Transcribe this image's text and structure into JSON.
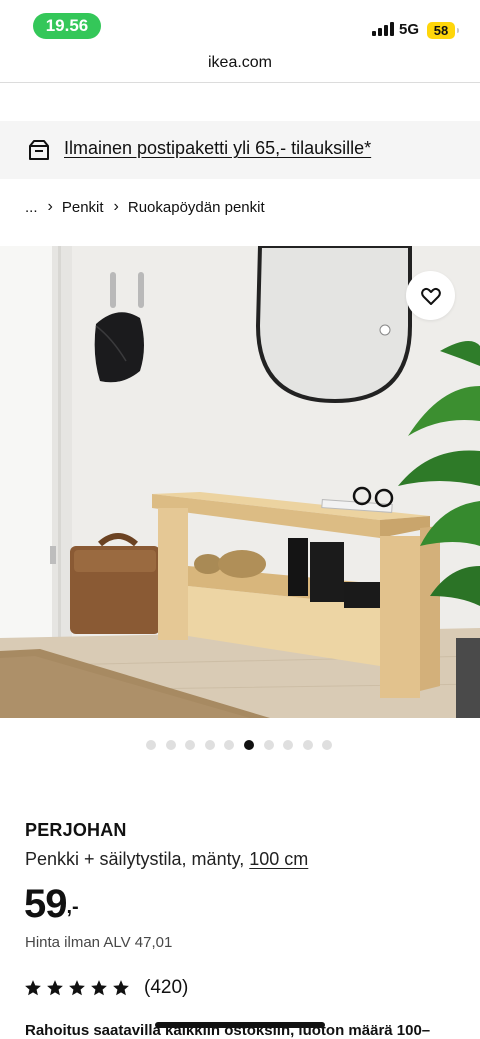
{
  "status_bar": {
    "time": "19.56",
    "network": "5G",
    "battery": "58"
  },
  "browser": {
    "url": "ikea.com"
  },
  "promo": {
    "icon": "delivery-box-icon",
    "text": "Ilmainen postipaketti yli 65,- tilauksille*"
  },
  "breadcrumb": {
    "ellipsis": "...",
    "items": [
      "Penkit",
      "Ruokapöydän penkit"
    ]
  },
  "product_image": {
    "favorite_icon": "heart-icon",
    "dots_count": 10,
    "active_index": 5
  },
  "product": {
    "name": "PERJOHAN",
    "description": "Penkki + säilytystila, mänty,",
    "size_link": "100 cm",
    "price": "59",
    "price_suffix": ",-",
    "vat_text": "Hinta ilman ALV 47,01",
    "rating_stars": 5,
    "rating_count": "(420)",
    "financing_text": "Rahoitus saatavilla kaikkiin ostoksiin, luoton määrä 100–"
  },
  "colors": {
    "accent_green": "#34c759",
    "battery_yellow": "#ffd60a",
    "banner_bg": "#f5f5f5"
  }
}
